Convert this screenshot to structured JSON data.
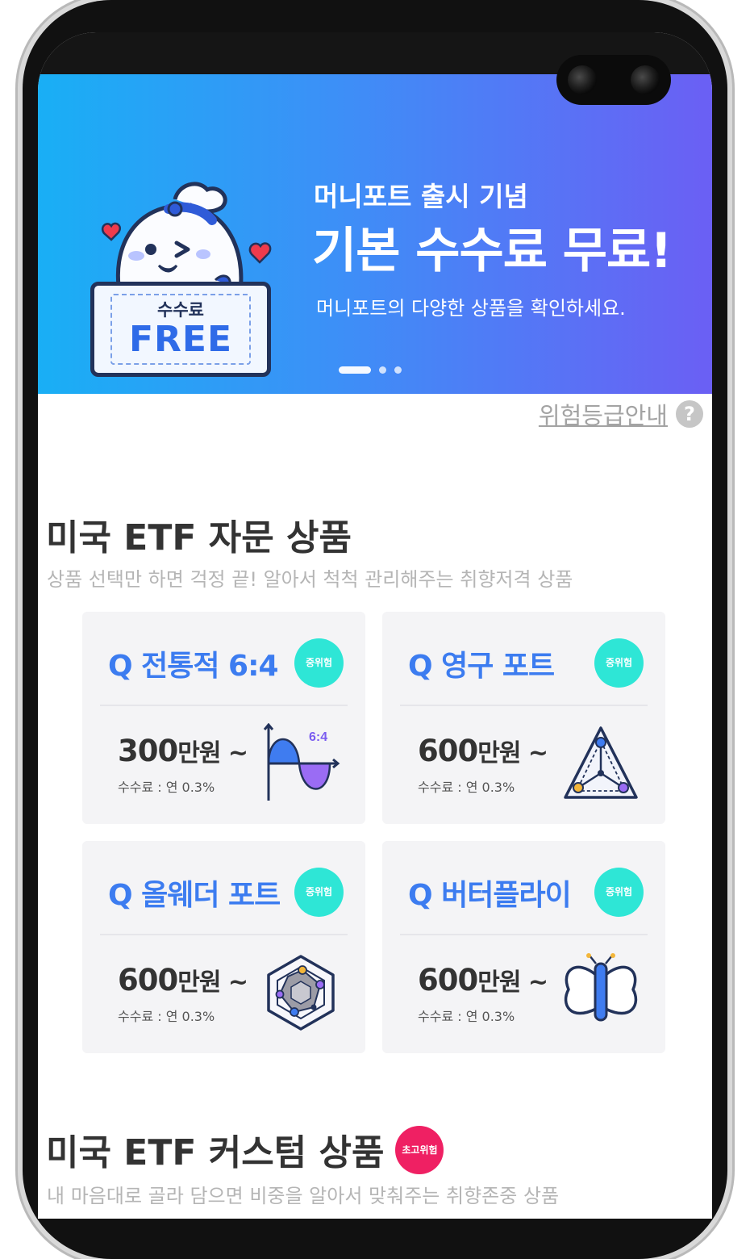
{
  "banner": {
    "subtitle": "머니포트 출시 기념",
    "headline": "기본 수수료 무료!",
    "description": "머니포트의 다양한 상품을 확인하세요.",
    "ticket_label": "수수료",
    "ticket_value": "FREE",
    "page_count": 3,
    "active_page": 1
  },
  "risk_guide": {
    "label": "위험등급안내",
    "icon": "question-icon"
  },
  "section_advisory": {
    "title": "미국 ETF 자문 상품",
    "subtitle": "상품 선택만 하면 걱정 끝! 알아서 척척 관리해주는 취향저격 상품",
    "products": [
      {
        "name": "Q 전통적 6:4",
        "risk": "중위험",
        "price": "300",
        "price_unit": "만원 ~",
        "fee": "수수료 : 연 0.3%",
        "icon": "sine-wave-chart-icon",
        "icon_label": "6:4"
      },
      {
        "name": "Q 영구 포트",
        "risk": "중위험",
        "price": "600",
        "price_unit": "만원 ~",
        "fee": "수수료 : 연 0.3%",
        "icon": "triangle-network-icon"
      },
      {
        "name": "Q 올웨더 포트",
        "risk": "중위험",
        "price": "600",
        "price_unit": "만원 ~",
        "fee": "수수료 : 연 0.3%",
        "icon": "hexagon-radar-icon"
      },
      {
        "name": "Q 버터플라이",
        "risk": "중위험",
        "price": "600",
        "price_unit": "만원 ~",
        "fee": "수수료 : 연 0.3%",
        "icon": "butterfly-icon"
      }
    ]
  },
  "section_custom": {
    "title": "미국 ETF 커스텀 상품",
    "risk": "초고위험",
    "subtitle": "내 마음대로 골라 담으면 비중을 알아서 맞춰주는 취향존중 상품"
  },
  "colors": {
    "accent": "#3c7cf0",
    "mid_risk": "#2ee6d6",
    "high_risk": "#ef2063",
    "banner_start": "#19aff5",
    "banner_end": "#6b5ff4"
  }
}
